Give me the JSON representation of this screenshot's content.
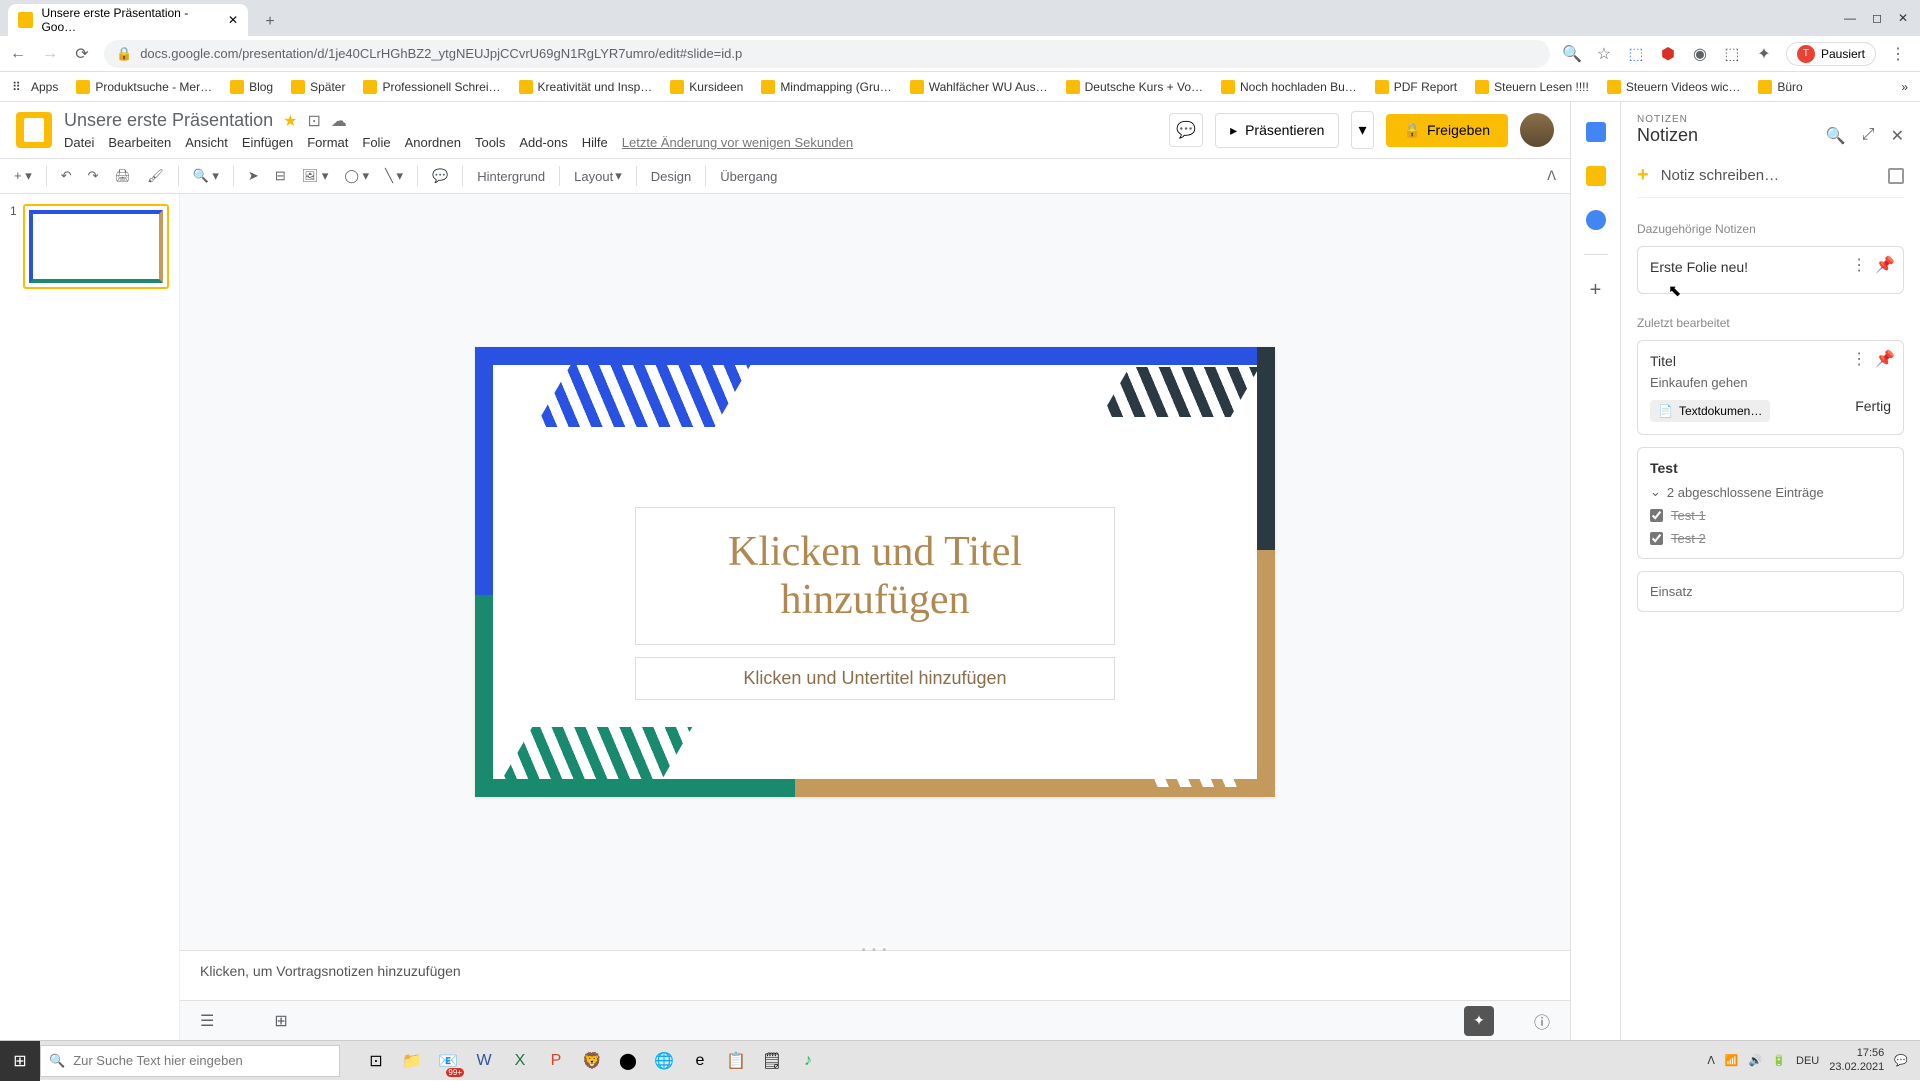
{
  "tab": {
    "title": "Unsere erste Präsentation - Goo…"
  },
  "url": "docs.google.com/presentation/d/1je40CLrHGhBZ2_ytgNEUJpjCCvrU69gN1RgLYR7umro/edit#slide=id.p",
  "profile": {
    "status": "Pausiert",
    "initial": "T"
  },
  "bookmarks": {
    "apps": "Apps",
    "items": [
      "Produktsuche - Mer…",
      "Blog",
      "Später",
      "Professionell Schrei…",
      "Kreativität und Insp…",
      "Kursideen",
      "Mindmapping  (Gru…",
      "Wahlfächer WU Aus…",
      "Deutsche Kurs + Vo…",
      "Noch hochladen Bu…",
      "PDF Report",
      "Steuern Lesen !!!!",
      "Steuern Videos wic…",
      "Büro"
    ]
  },
  "doc": {
    "title": "Unsere erste Präsentation",
    "menu": [
      "Datei",
      "Bearbeiten",
      "Ansicht",
      "Einfügen",
      "Format",
      "Folie",
      "Anordnen",
      "Tools",
      "Add-ons",
      "Hilfe"
    ],
    "last_edit": "Letzte Änderung vor wenigen Sekunden",
    "present": "Präsentieren",
    "share": "Freigeben"
  },
  "toolbar": {
    "bg": "Hintergrund",
    "layout": "Layout",
    "design": "Design",
    "transition": "Übergang"
  },
  "slide": {
    "num": "1",
    "title_placeholder": "Klicken und Titel hinzufügen",
    "subtitle_placeholder": "Klicken und Untertitel hinzufügen",
    "notes_placeholder": "Klicken, um Vortragsnotizen hinzuzufügen"
  },
  "keep": {
    "eyebrow": "NOTIZEN",
    "title": "Notizen",
    "new_label": "Notiz schreiben…",
    "section_related": "Dazugehörige Notizen",
    "related_note": "Erste Folie neu!",
    "section_recent": "Zuletzt bearbeitet",
    "card1": {
      "title": "Titel",
      "subtitle": "Einkaufen gehen",
      "chip": "Textdokumen…",
      "done": "Fertig"
    },
    "card2": {
      "title": "Test",
      "collapse": "2 abgeschlossene Einträge",
      "item1": "Test 1",
      "item2": "Test 2"
    },
    "card3": {
      "title": "Einsatz"
    }
  },
  "taskbar": {
    "search": "Zur Suche Text hier eingeben",
    "badge": "99+",
    "lang": "DEU",
    "time": "17:56",
    "date": "23.02.2021"
  }
}
